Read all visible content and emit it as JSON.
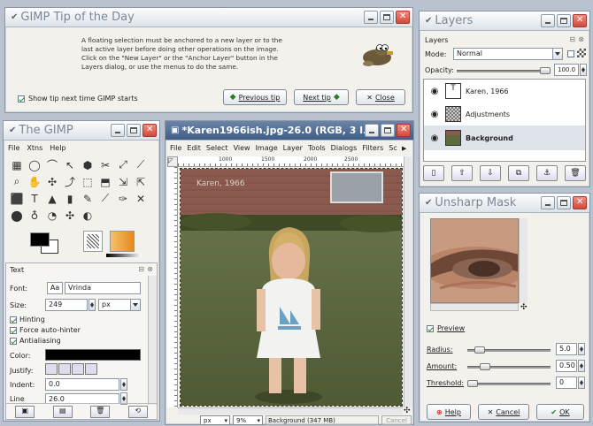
{
  "tip": {
    "title": "GIMP Tip of the Day",
    "text": "A floating selection must be anchored to a new layer or to the last active layer before doing other operations on the image. Click on the \"New Layer\" or the \"Anchor Layer\" button in the Layers dialog, or use the menus to do the same.",
    "show_tip_label": "Show tip next time GIMP starts",
    "prev_label": "Previous tip",
    "next_label": "Next tip",
    "close_label": "Close"
  },
  "toolbox": {
    "title": "The GIMP",
    "menu": [
      "File",
      "Xtns",
      "Help"
    ],
    "tools": [
      "▦",
      "◯",
      "⌒",
      "↖",
      "⬢",
      "✂",
      "⤢",
      "⟋",
      "⌕",
      "✋",
      "✣",
      "⤴",
      "⬚",
      "⬒",
      "⇲",
      "⇱",
      "⬛",
      "T",
      "▲",
      "▮",
      "✎",
      "⟋",
      "✑",
      "✕",
      "⬤",
      "♁",
      "◔",
      "✣",
      "◐"
    ]
  },
  "text_opts": {
    "header": "Text",
    "font_label": "Font:",
    "font_value": "Vrinda",
    "font_preview": "Aa",
    "size_label": "Size:",
    "size_value": "249",
    "size_unit": "px",
    "hinting": "Hinting",
    "force": "Force auto-hinter",
    "antialias": "Antialiasing",
    "color_label": "Color:",
    "justify_label": "Justify:",
    "indent_label": "Indent:",
    "indent_value": "0.0",
    "line_label": "Line",
    "line_value": "26.0"
  },
  "image": {
    "title": "*Karen1966ish.jpg-26.0 (RGB, 3 l...",
    "menu": [
      "File",
      "Edit",
      "Select",
      "View",
      "Image",
      "Layer",
      "Tools",
      "Dialogs",
      "Filters",
      "Sc"
    ],
    "ruler_ticks": [
      "1000",
      "1500",
      "2000",
      "2500"
    ],
    "photo_caption": "Karen, 1966",
    "unit": "px",
    "zoom": "9%",
    "status": "Background (347 MB)",
    "cancel": "Cancel"
  },
  "layers": {
    "title": "Layers",
    "subtitle": "Layers",
    "mode_label": "Mode:",
    "mode_value": "Normal",
    "opacity_label": "Opacity:",
    "opacity_value": "100.0",
    "items": [
      {
        "name": "Karen, 1966"
      },
      {
        "name": "Adjustments"
      },
      {
        "name": "Background"
      }
    ]
  },
  "unsharp": {
    "title": "Unsharp Mask",
    "preview_label": "Preview",
    "radius_label": "Radius:",
    "radius_value": "5.0",
    "amount_label": "Amount:",
    "amount_value": "0.50",
    "threshold_label": "Threshold:",
    "threshold_value": "0",
    "help": "Help",
    "cancel": "Cancel",
    "ok": "OK"
  }
}
